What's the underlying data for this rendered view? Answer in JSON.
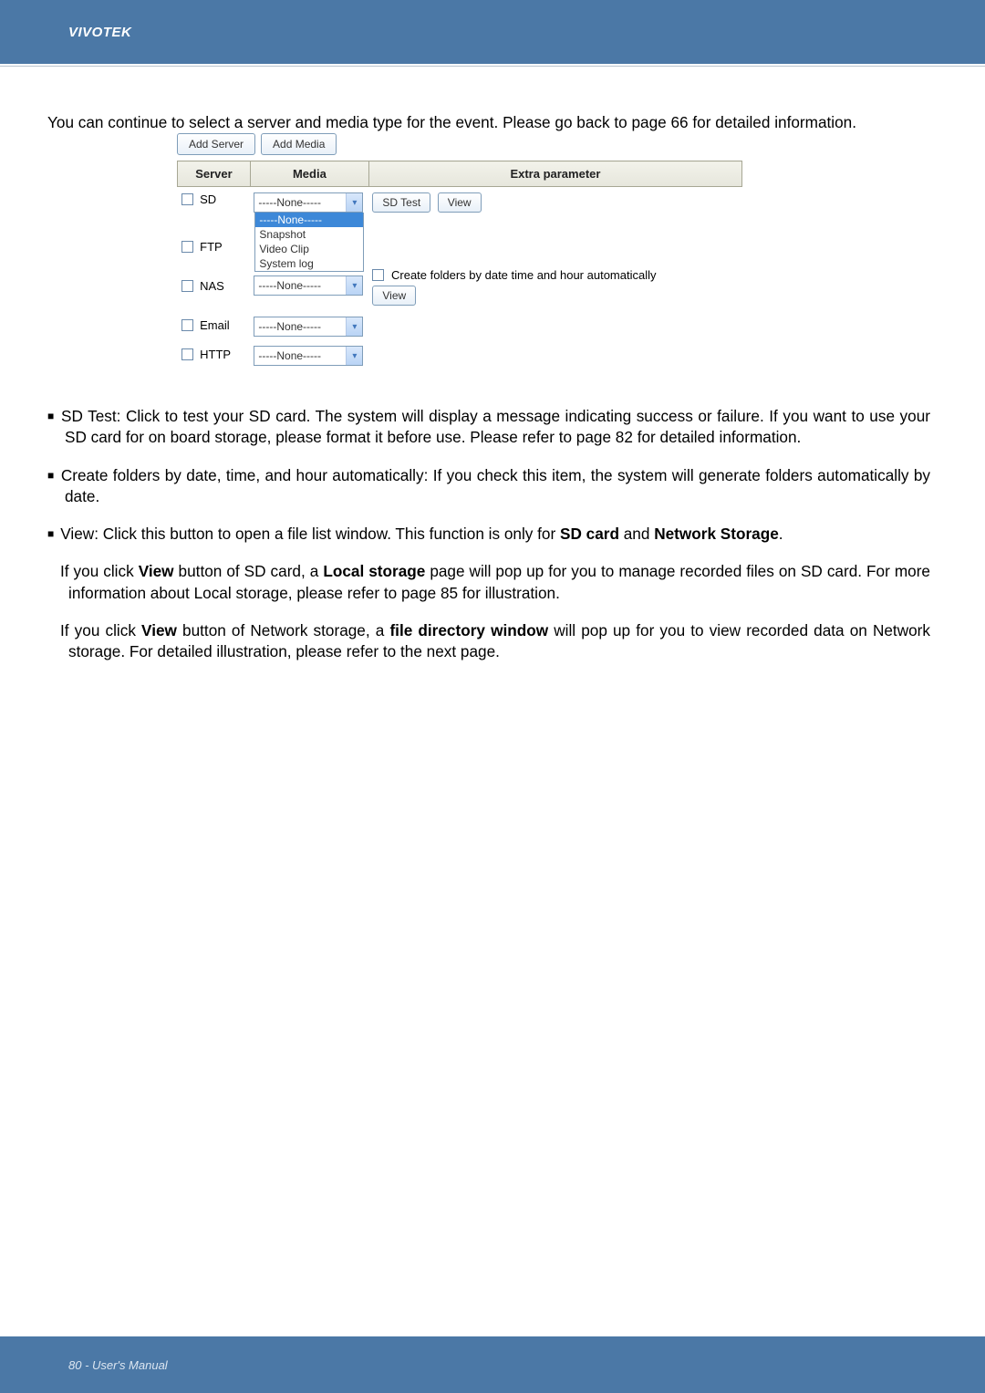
{
  "header": {
    "brand": "VIVOTEK"
  },
  "intro": "You can continue to select a server and media type for the event. Please go back to page 66 for detailed information.",
  "screenshot": {
    "add_server": "Add Server",
    "add_media": "Add Media",
    "th_server": "Server",
    "th_media": "Media",
    "th_extra": "Extra parameter",
    "none": "-----None-----",
    "dropdown": {
      "opt_none": "-----None-----",
      "opt_snapshot": "Snapshot",
      "opt_videoclip": "Video Clip",
      "opt_systemlog": "System log"
    },
    "rows": {
      "sd": "SD",
      "ftp": "FTP",
      "nas": "NAS",
      "email": "Email",
      "http": "HTTP"
    },
    "btn_sdtest": "SD Test",
    "btn_view": "View",
    "create_folders": "Create folders by date time and hour automatically"
  },
  "bullets": {
    "b1a": "SD Test: Click to test your SD card. The system will display a message indicating success or failure. If you want to use your SD card for on board storage, please format it before use. Please refer to page 82 for detailed information.",
    "b2a": "Create folders by date, time, and hour automatically: If you check this item, the system will generate folders automatically by date.",
    "b3_pre": "View: Click this button to open a file list window. This function is only for ",
    "b3_sd": "SD card",
    "b3_and": " and ",
    "b3_ns": "Network Storage",
    "b3_post": ".",
    "p1_pre": "If you click ",
    "p1_view": "View",
    "p1_mid": " button of SD card, a ",
    "p1_local": "Local storage",
    "p1_post": " page will pop up for you to manage recorded files on SD card. For more information about Local storage, please refer to page 85 for illustration.",
    "p2_pre": "If you click ",
    "p2_view": "View",
    "p2_mid": " button of Network storage, a ",
    "p2_fdw": "file directory window",
    "p2_post": " will pop up for you to view recorded data on Network storage. For detailed illustration, please refer to the next page."
  },
  "footer": {
    "text": "80 - User's Manual"
  }
}
